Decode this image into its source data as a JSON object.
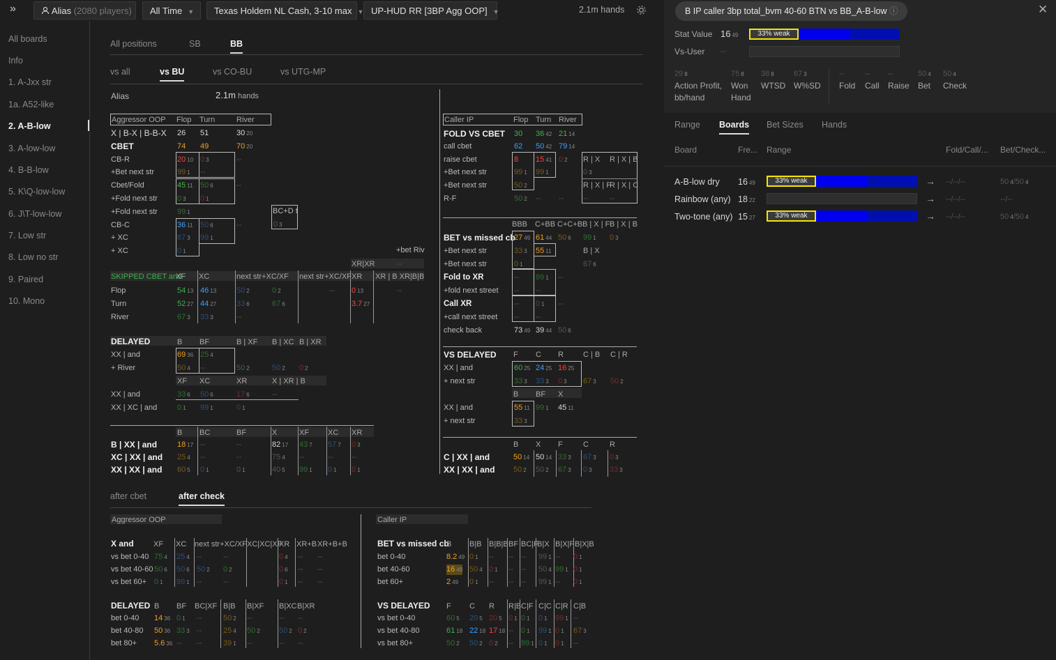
{
  "topbar": {
    "expand_icon": "»",
    "player": "Alias",
    "players_count": "(2080 players)",
    "time": "All Time",
    "game": "Texas Holdem NL Cash, 3-10 max",
    "hud": "UP-HUD RR [3BP Agg OOP]",
    "hands": "2.1m hands"
  },
  "sidebar": [
    "All boards",
    "Info",
    "1. A-Jxx str",
    "1a. A52-like",
    "2. A-B-low",
    "3. A-low-low",
    "4. B-B-low",
    "5. K\\Q-low-low",
    "6. J\\T-low-low",
    "7. Low str",
    "8. Low no str",
    "9. Paired",
    "10. Mono"
  ],
  "pos_tabs": [
    "All positions",
    "SB",
    "BB"
  ],
  "vs_tabs": [
    "vs all",
    "vs BU",
    "vs CO-BU",
    "vs UTG-MP"
  ],
  "alias": {
    "label": "Alias",
    "hands": "2.1m",
    "hands_unit": "hands"
  },
  "bottom_tabs": [
    "after cbet",
    "after check"
  ],
  "agg_oop": {
    "title": "Aggressor OOP",
    "cols": [
      "Flop",
      "Turn",
      "River"
    ],
    "rows": [
      {
        "label": "X | B-X | B-B-X",
        "v": [
          "26",
          "51",
          "30"
        ],
        "s": [
          "",
          "",
          "20"
        ]
      },
      {
        "label": "CBET",
        "v": [
          "74",
          "49",
          "70"
        ],
        "s": [
          "",
          "",
          "20"
        ]
      },
      {
        "label": "CB-R",
        "v": [
          "20",
          "0",
          "--"
        ],
        "s": [
          "10",
          "3",
          ""
        ]
      },
      {
        "label": "+Bet next str",
        "v": [
          "99",
          "--",
          ""
        ],
        "s": [
          "1",
          "",
          ""
        ]
      },
      {
        "label": "Cbet/Fold",
        "v": [
          "45",
          "50",
          "--"
        ],
        "s": [
          "11",
          "6",
          ""
        ]
      },
      {
        "label": "+Fold next str",
        "v": [
          "0",
          "0",
          ""
        ],
        "s": [
          "3",
          "1",
          ""
        ]
      },
      {
        "label": "+Fold next str",
        "v": [
          "99",
          ""
        ],
        "s": [
          "1",
          ""
        ]
      },
      {
        "label": "CB-C",
        "v": [
          "36",
          "50",
          "--"
        ],
        "s": [
          "11",
          "6",
          ""
        ]
      },
      {
        "label": "+ XC",
        "v": [
          "67",
          "99",
          ""
        ],
        "s": [
          "3",
          "1",
          ""
        ]
      },
      {
        "label": "+ XC",
        "v": [
          "0"
        ],
        "s": [
          "1"
        ]
      }
    ],
    "bcd": "BC+D t",
    "bcd_v": "0",
    "bcd_s": "3",
    "bet_riv": "+bet Riv",
    "xr_xr": "XR|XR",
    "dash": "--"
  },
  "skipped": {
    "title": "SKIPPED CBET and",
    "cols": [
      "XF",
      "XC",
      "next str+XC/XF",
      "next str+XC/XF",
      "XR",
      "XR | B XR|B|B"
    ],
    "rows": [
      {
        "label": "Flop",
        "v": [
          "54",
          "46",
          "50",
          "0",
          "--",
          "0",
          "--"
        ],
        "s": [
          "13",
          "13",
          "2",
          "2",
          "",
          "13",
          ""
        ]
      },
      {
        "label": "Turn",
        "v": [
          "52",
          "44",
          "33",
          "67",
          "3.7"
        ],
        "s": [
          "27",
          "27",
          "6",
          "6",
          "27"
        ]
      },
      {
        "label": "River",
        "v": [
          "67",
          "33",
          "--"
        ],
        "s": [
          "3",
          "3",
          ""
        ]
      }
    ]
  },
  "delayed": {
    "title": "DELAYED",
    "cols": [
      "B",
      "BF",
      "B | XF",
      "B | XC",
      "B | XR"
    ],
    "rows": [
      {
        "label": "XX | and",
        "v": [
          "69",
          "25"
        ],
        "s": [
          "36",
          "4"
        ]
      },
      {
        "label": "+ River",
        "v": [
          "50",
          "--",
          "50",
          "50",
          "0"
        ],
        "s": [
          "4",
          "",
          "2",
          "2",
          "2"
        ]
      }
    ],
    "cols2": [
      "XF",
      "XC",
      "XR",
      "X | XR | B"
    ],
    "rows2": [
      {
        "label": "XX | and",
        "v": [
          "33",
          "50",
          "17",
          "--"
        ],
        "s": [
          "6",
          "6",
          "6",
          ""
        ]
      },
      {
        "label": "XX | XC | and",
        "v": [
          "0",
          "99",
          "0"
        ],
        "s": [
          "1",
          "1",
          "1"
        ]
      }
    ]
  },
  "bxx": {
    "cols": [
      "B",
      "BC",
      "BF",
      "X",
      "XF",
      "XC",
      "XR"
    ],
    "rows": [
      {
        "label": "B | XX | and",
        "v": [
          "18",
          "--",
          "--",
          "82",
          "43",
          "57",
          "0"
        ],
        "s": [
          "17",
          "",
          "",
          "17",
          "7",
          "7",
          "3"
        ]
      },
      {
        "label": "XC | XX | and",
        "v": [
          "25",
          "--",
          "--",
          "75",
          "--",
          "--",
          "--"
        ],
        "s": [
          "4",
          "",
          "",
          "4",
          "",
          "",
          ""
        ]
      },
      {
        "label": "XX | XX | and",
        "v": [
          "60",
          "0",
          "0",
          "40",
          "99",
          "0",
          "0"
        ],
        "s": [
          "5",
          "1",
          "1",
          "5",
          "1",
          "1",
          "1"
        ]
      }
    ]
  },
  "caller_ip": {
    "title": "Caller IP",
    "cols": [
      "Flop",
      "Turn",
      "River"
    ],
    "rows": [
      {
        "label": "FOLD VS CBET",
        "v": [
          "30",
          "36",
          "21"
        ],
        "s": [
          "",
          "42",
          "14"
        ]
      },
      {
        "label": "call cbet",
        "v": [
          "62",
          "50",
          "79"
        ],
        "s": [
          "",
          "42",
          "14"
        ]
      },
      {
        "label": "raise cbet",
        "v": [
          "8",
          "15",
          "0"
        ],
        "s": [
          "",
          "41",
          "2"
        ]
      },
      {
        "label": "+Bet next str",
        "v": [
          "99",
          "99"
        ],
        "s": [
          "1",
          "1"
        ]
      },
      {
        "label": "+Bet next str",
        "v": [
          "50"
        ],
        "s": [
          "2"
        ]
      },
      {
        "label": "R-F",
        "v": [
          "50",
          "--",
          "--"
        ],
        "s": [
          "2",
          "",
          ""
        ]
      }
    ],
    "rx": [
      "R | X",
      "R | X | B",
      "R | X | F",
      "R | X | C"
    ],
    "rx_v": [
      "0",
      "--",
      "--"
    ],
    "rx_s": [
      "3",
      "",
      ""
    ]
  },
  "bet_missed": {
    "cols": [
      "BBB",
      "C+BB",
      "C+C+B",
      "B | X | F",
      "B | X | B"
    ],
    "rows": [
      {
        "label": "BET vs missed cb",
        "v": [
          "27",
          "61",
          "50",
          "99",
          "0"
        ],
        "s": [
          "49",
          "44",
          "6",
          "1",
          "3"
        ]
      },
      {
        "label": "+Bet next str",
        "v": [
          "33",
          "55"
        ],
        "s": [
          "3",
          "11"
        ]
      },
      {
        "label": "+Bet next str",
        "v": [
          "0"
        ],
        "s": [
          "1"
        ]
      },
      {
        "label": "Fold to XR",
        "v": [
          "--",
          "99",
          "--"
        ],
        "s": [
          "",
          "1",
          ""
        ]
      },
      {
        "label": "+fold next street",
        "v": [
          "--",
          "--"
        ],
        "s": [
          "",
          ""
        ]
      },
      {
        "label": "Call XR",
        "v": [
          "--",
          "0",
          "--"
        ],
        "s": [
          "",
          "1",
          ""
        ]
      },
      {
        "label": "+call next street",
        "v": [
          "--",
          "--"
        ],
        "s": [
          "",
          ""
        ]
      },
      {
        "label": "check back",
        "v": [
          "73",
          "39",
          "50"
        ],
        "s": [
          "49",
          "44",
          "6"
        ]
      }
    ],
    "bx": "B | X",
    "bx_v": "67",
    "bx_s": "6"
  },
  "vs_delayed": {
    "title": "VS DELAYED",
    "cols": [
      "F",
      "C",
      "R",
      "C | B",
      "C | R"
    ],
    "rows": [
      {
        "label": "XX | and",
        "v": [
          "60",
          "24",
          "16"
        ],
        "s": [
          "25",
          "25",
          "25"
        ]
      },
      {
        "label": "+ next str",
        "v": [
          "33",
          "33",
          "0",
          "67",
          "50"
        ],
        "s": [
          "3",
          "3",
          "3",
          "3",
          "2"
        ]
      }
    ],
    "cols2": [
      "B",
      "BF",
      "X"
    ],
    "rows2": [
      {
        "label": "XX | and",
        "v": [
          "55",
          "99",
          "45"
        ],
        "s": [
          "11",
          "1",
          "11"
        ]
      },
      {
        "label": "+ next str",
        "v": [
          "33"
        ],
        "s": [
          "3"
        ]
      }
    ]
  },
  "cxx": {
    "cols": [
      "B",
      "X",
      "F",
      "C",
      "R"
    ],
    "rows": [
      {
        "label": "C | XX | and",
        "v": [
          "50",
          "50",
          "33",
          "67",
          "0"
        ],
        "s": [
          "14",
          "14",
          "3",
          "3",
          "3"
        ]
      },
      {
        "label": "XX | XX | and",
        "v": [
          "50",
          "50",
          "67",
          "0",
          "33"
        ],
        "s": [
          "2",
          "2",
          "3",
          "3",
          "3"
        ]
      }
    ]
  },
  "bot_agg": {
    "title": "Aggressor OOP",
    "x_title": "X and",
    "x_cols": [
      "XF",
      "XC",
      "next str+XC/XF",
      "XC|XC|XF",
      "XR",
      "XR+B",
      "XR+B+B"
    ],
    "x_rows": [
      {
        "label": "vs bet 0-40",
        "v": [
          "75",
          "25",
          "--",
          "--",
          "0",
          "--",
          "--"
        ],
        "s": [
          "4",
          "4",
          "",
          "",
          "4",
          "",
          ""
        ]
      },
      {
        "label": "vs bet 40-60",
        "v": [
          "50",
          "50",
          "50",
          "0",
          "0",
          "--",
          "--"
        ],
        "s": [
          "6",
          "6",
          "2",
          "2",
          "6",
          "",
          ""
        ]
      },
      {
        "label": "vs bet 60+",
        "v": [
          "0",
          "99",
          "--",
          "--",
          "0",
          "--",
          "--"
        ],
        "s": [
          "1",
          "1",
          "",
          "",
          "1",
          "",
          ""
        ]
      }
    ],
    "d_title": "DELAYED",
    "d_cols": [
      "B",
      "BF",
      "BC|XF",
      "B|B",
      "B|XF",
      "B|XC",
      "B|XR"
    ],
    "d_rows": [
      {
        "label": "bet 0-40",
        "v": [
          "14",
          "0",
          "--",
          "50",
          "--",
          "--",
          "--"
        ],
        "s": [
          "36",
          "1",
          "",
          "2",
          "",
          "",
          ""
        ]
      },
      {
        "label": "bet 40-80",
        "v": [
          "50",
          "33",
          "--",
          "25",
          "50",
          "50",
          "0"
        ],
        "s": [
          "36",
          "3",
          "",
          "4",
          "2",
          "2",
          "2"
        ]
      },
      {
        "label": "bet 80+",
        "v": [
          "5.6",
          "--",
          "--",
          "39",
          "--",
          "--",
          "--"
        ],
        "s": [
          "36",
          "",
          "",
          "1",
          "",
          "",
          ""
        ]
      }
    ]
  },
  "bot_caller": {
    "title": "Caller IP",
    "b_title": "BET vs missed cb",
    "b_cols": [
      "B",
      "B|B",
      "B|B|B",
      "BF",
      "BC|F",
      "B|X",
      "B|X|F",
      "B|X|B"
    ],
    "b_rows": [
      {
        "label": "bet 0-40",
        "v": [
          "8.2",
          "0",
          "--",
          "--",
          "--",
          "99",
          "--",
          "0"
        ],
        "s": [
          "49",
          "1",
          "",
          "",
          "",
          "1",
          "",
          "1"
        ]
      },
      {
        "label": "bet 40-60",
        "v": [
          "16",
          "50",
          "0",
          "--",
          "--",
          "50",
          "99",
          "0"
        ],
        "s": [
          "49",
          "4",
          "1",
          "",
          "",
          "4",
          "1",
          "1"
        ]
      },
      {
        "label": "bet 60+",
        "v": [
          "2",
          "0",
          "--",
          "--",
          "--",
          "99",
          "--",
          "0"
        ],
        "s": [
          "49",
          "1",
          "",
          "",
          "",
          "1",
          "",
          "1"
        ]
      }
    ],
    "v_title": "VS DELAYED",
    "v_cols": [
      "F",
      "C",
      "R",
      "R|B",
      "C|F",
      "C|C",
      "C|R",
      "C|B"
    ],
    "v_rows": [
      {
        "label": "vs bet 0-40",
        "v": [
          "60",
          "20",
          "20",
          "0",
          "0",
          "0",
          "99",
          "--"
        ],
        "s": [
          "5",
          "5",
          "5",
          "1",
          "1",
          "1",
          "1",
          ""
        ]
      },
      {
        "label": "vs bet 40-80",
        "v": [
          "61",
          "22",
          "17",
          "--",
          "0",
          "99",
          "0",
          "67"
        ],
        "s": [
          "18",
          "18",
          "18",
          "",
          "1",
          "1",
          "1",
          "3"
        ]
      },
      {
        "label": "vs bet 80+",
        "v": [
          "50",
          "50",
          "0",
          "--",
          "99",
          "0",
          "0",
          "--"
        ],
        "s": [
          "2",
          "2",
          "2",
          "",
          "1",
          "1",
          "1",
          ""
        ]
      }
    ]
  },
  "right": {
    "pill": "B IP caller 3bp total_bvm 40-60 BTN vs BB_A-B-low",
    "info_icon": "ⓘ",
    "stat_label": "Stat Value",
    "stat_value": "16",
    "stat_sub": "49",
    "stat_badge": "33% weak",
    "stat_fill": 0.33,
    "stat_split": 0.67,
    "vs_user_label": "Vs-User",
    "vs_user_value": "--",
    "mini": [
      {
        "v": "29",
        "s": "8",
        "label": "Action Profit,",
        "label2": "bb/hand"
      },
      {
        "v": "75",
        "s": "8",
        "label": "Won",
        "label2": "Hand"
      },
      {
        "v": "38",
        "s": "8",
        "label": "WTSD",
        "label2": ""
      },
      {
        "v": "67",
        "s": "3",
        "label": "W%SD",
        "label2": ""
      },
      {
        "v": "--",
        "s": "",
        "label": "Fold",
        "label2": ""
      },
      {
        "v": "--",
        "s": "",
        "label": "Call",
        "label2": ""
      },
      {
        "v": "--",
        "s": "",
        "label": "Raise",
        "label2": ""
      },
      {
        "v": "50",
        "s": "4",
        "label": "Bet",
        "label2": ""
      },
      {
        "v": "50",
        "s": "4",
        "label": "Check",
        "label2": ""
      }
    ],
    "tabs": [
      "Range",
      "Boards",
      "Bet Sizes",
      "Hands"
    ],
    "cols": [
      "Board",
      "Fre...",
      "Range",
      "Fold/Call/...",
      "Bet/Check..."
    ],
    "rows": [
      {
        "board": "A-B-low dry",
        "v": "16",
        "s": "49",
        "badge": "33% weak",
        "has_bar": true,
        "arrow": "→",
        "fcr": "--/--/--",
        "bc": "50",
        "bc_s": "4",
        "bc2": "/50",
        "bc2_s": "4"
      },
      {
        "board": "Rainbow (any)",
        "v": "18",
        "s": "22",
        "badge": "",
        "has_bar": false,
        "arrow": "→",
        "fcr": "--/--/--",
        "bc": "--/--",
        "bc_s": "",
        "bc2": "",
        "bc2_s": ""
      },
      {
        "board": "Two-tone (any)",
        "v": "15",
        "s": "27",
        "badge": "33% weak",
        "has_bar": true,
        "arrow": "→",
        "fcr": "--/--/--",
        "bc": "50",
        "bc_s": "4",
        "bc2": "/50",
        "bc2_s": "4"
      }
    ],
    "close_icon": "✕"
  },
  "colors": {
    "green": "#3cb44b",
    "orange": "#f0a020",
    "blue": "#3ca0ff",
    "red": "#ff4040",
    "badge": "#f5e600",
    "bar": "#0000ee"
  }
}
